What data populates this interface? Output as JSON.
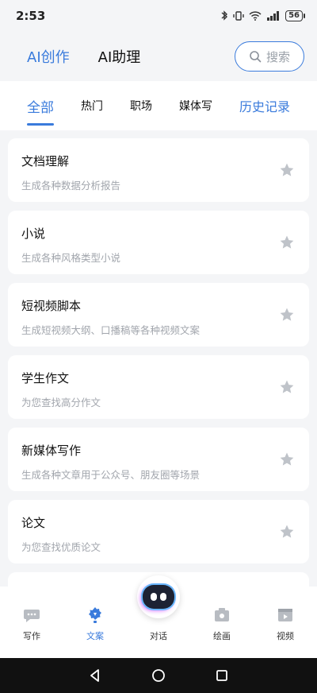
{
  "status": {
    "time": "2:53",
    "battery": "56"
  },
  "header": {
    "tabs": [
      {
        "label": "AI创作",
        "active": true
      },
      {
        "label": "AI助理",
        "active": false
      }
    ],
    "search_placeholder": "搜索"
  },
  "categories": {
    "items": [
      {
        "label": "全部",
        "active": true
      },
      {
        "label": "热门"
      },
      {
        "label": "职场"
      },
      {
        "label": "媒体写"
      }
    ],
    "history": "历史记录"
  },
  "cards": [
    {
      "title": "文档理解",
      "desc": "生成各种数据分析报告"
    },
    {
      "title": "小说",
      "desc": "生成各种风格类型小说"
    },
    {
      "title": "短视频脚本",
      "desc": "生成短视频大纲、口播稿等各种视频文案"
    },
    {
      "title": "学生作文",
      "desc": "为您查找高分作文"
    },
    {
      "title": "新媒体写作",
      "desc": "生成各种文章用于公众号、朋友圈等场景"
    },
    {
      "title": "论文",
      "desc": "为您查找优质论文"
    }
  ],
  "tabbar": {
    "items": [
      {
        "label": "写作",
        "icon": "chat-bubble-icon"
      },
      {
        "label": "文案",
        "icon": "lightbulb-icon",
        "active": true
      },
      {
        "label": "对话",
        "icon": "robot-icon"
      },
      {
        "label": "绘画",
        "icon": "palette-icon"
      },
      {
        "label": "视频",
        "icon": "video-icon"
      }
    ]
  },
  "colors": {
    "accent": "#3a7bdc",
    "star": "#bfc3c9"
  }
}
